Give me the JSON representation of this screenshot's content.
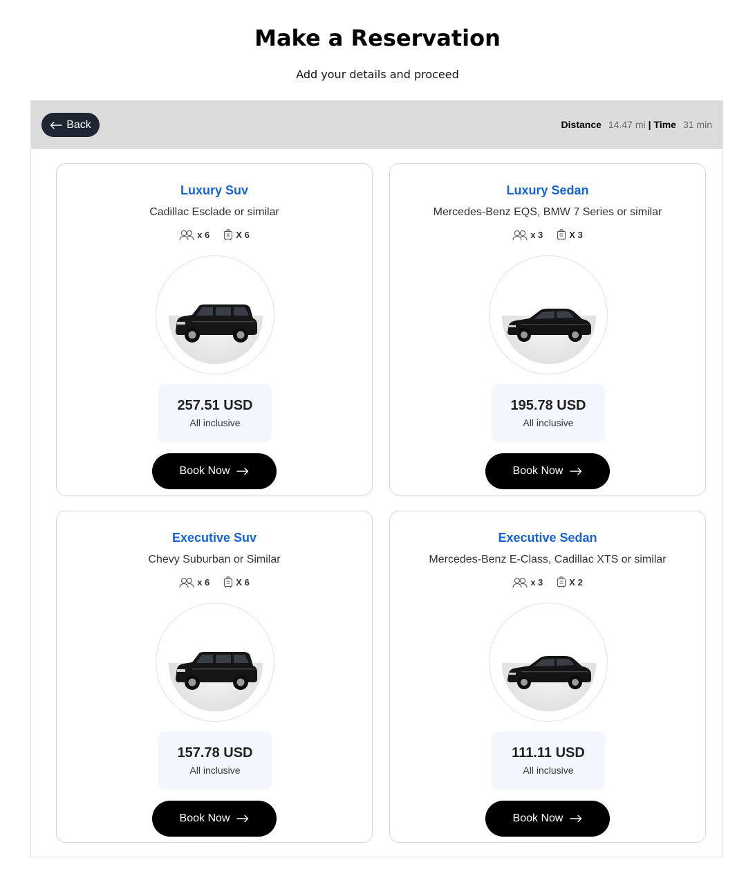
{
  "page": {
    "title": "Make a Reservation",
    "subtitle": "Add your details and proceed"
  },
  "header": {
    "back_label": "Back",
    "distance_label": "Distance",
    "distance_value": "14.47 mi",
    "separator": "|",
    "time_label": "Time",
    "time_value": "31 min"
  },
  "vehicles": [
    {
      "title": "Luxury Suv",
      "model": "Cadillac Esclade or similar",
      "passengers": "x 6",
      "luggage": "X 6",
      "image_icon": "suv-car-image",
      "price": "257.51 USD",
      "price_note": "All inclusive",
      "book_label": "Book Now"
    },
    {
      "title": "Luxury Sedan",
      "model": "Mercedes-Benz EQS, BMW 7 Series or similar",
      "passengers": "x 3",
      "luggage": "X 3",
      "image_icon": "sedan-car-image",
      "price": "195.78 USD",
      "price_note": "All inclusive",
      "book_label": "Book Now"
    },
    {
      "title": "Executive Suv",
      "model": "Chevy Suburban or Similar",
      "passengers": "x 6",
      "luggage": "X 6",
      "image_icon": "suv-car-image",
      "price": "157.78 USD",
      "price_note": "All inclusive",
      "book_label": "Book Now"
    },
    {
      "title": "Executive Sedan",
      "model": "Mercedes-Benz E-Class, Cadillac XTS or similar",
      "passengers": "x 3",
      "luggage": "X 2",
      "image_icon": "sedan-car-image",
      "price": "111.11 USD",
      "price_note": "All inclusive",
      "book_label": "Book Now"
    }
  ],
  "colors": {
    "accent": "#1563dc",
    "button_dark": "#000000",
    "back_button": "#1f2533",
    "header_bg": "#dcdcdc",
    "price_bg": "#f3f7fd"
  }
}
